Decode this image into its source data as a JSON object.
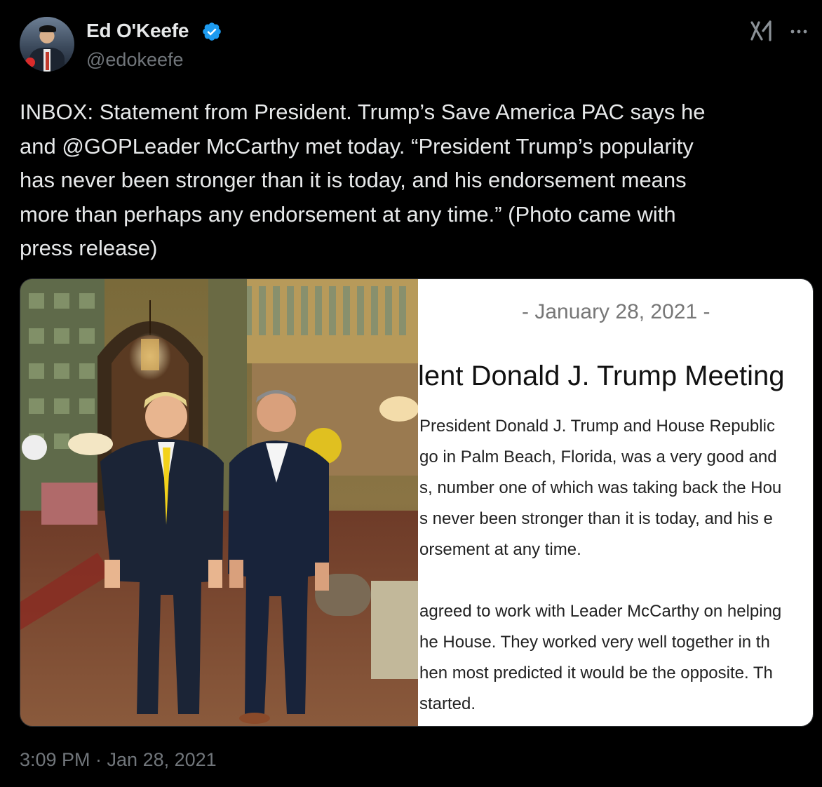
{
  "author": {
    "name": "Ed O'Keefe",
    "handle": "@edokeefe",
    "verified": true
  },
  "icons": {
    "verified": "verified-badge-icon",
    "grok": "grok-icon",
    "more": "more-options-icon"
  },
  "colors": {
    "background": "#000000",
    "text": "#e7e9ea",
    "secondary_text": "#71767b",
    "verified_blue": "#1d9bf0"
  },
  "tweet": {
    "text": "INBOX: Statement from President. Trump’s Save America PAC says he\nand @GOPLeader McCarthy met today. “President Trump’s popularity\nhas never been stronger than it is today, and his endorsement means\nmore than perhaps any endorsement at any time.” (Photo came with\npress release)",
    "timestamp": "3:09 PM · Jan 28, 2021"
  },
  "media": {
    "photo_description_icon": "photo-icon",
    "release": {
      "date": "- January 28, 2021 -",
      "headline": "lent Donald J. Trump Meeting",
      "lines": [
        "President Donald J. Trump and House Republic",
        "go in Palm Beach, Florida, was a very good and",
        "s, number one of which was taking back the Hou",
        "s never been stronger than it is today, and his e",
        "orsement at any time.",
        "agreed to work with Leader McCarthy on helping",
        "he House. They worked very well together in th",
        "hen most predicted it would be the opposite. Th",
        "started."
      ]
    }
  }
}
